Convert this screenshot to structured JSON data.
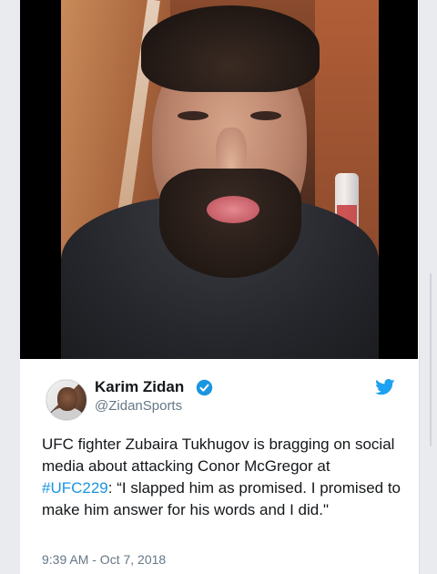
{
  "tweet": {
    "author_name": "Karim Zidan",
    "author_handle": "@ZidanSports",
    "verified_icon": "verified-badge-icon",
    "platform_icon": "twitter-bird-icon",
    "text_before": "UFC fighter Zubaira Tukhugov is bragging on social media about attacking Conor McGregor at ",
    "hashtag": "#UFC229",
    "text_after": ": “I slapped him as promised. I promised to make him answer for his words and I did.\"",
    "timestamp": "9:39 AM - Oct 7, 2018"
  },
  "colors": {
    "accent": "#1b95e0",
    "name": "#14171a",
    "muted": "#657786"
  }
}
